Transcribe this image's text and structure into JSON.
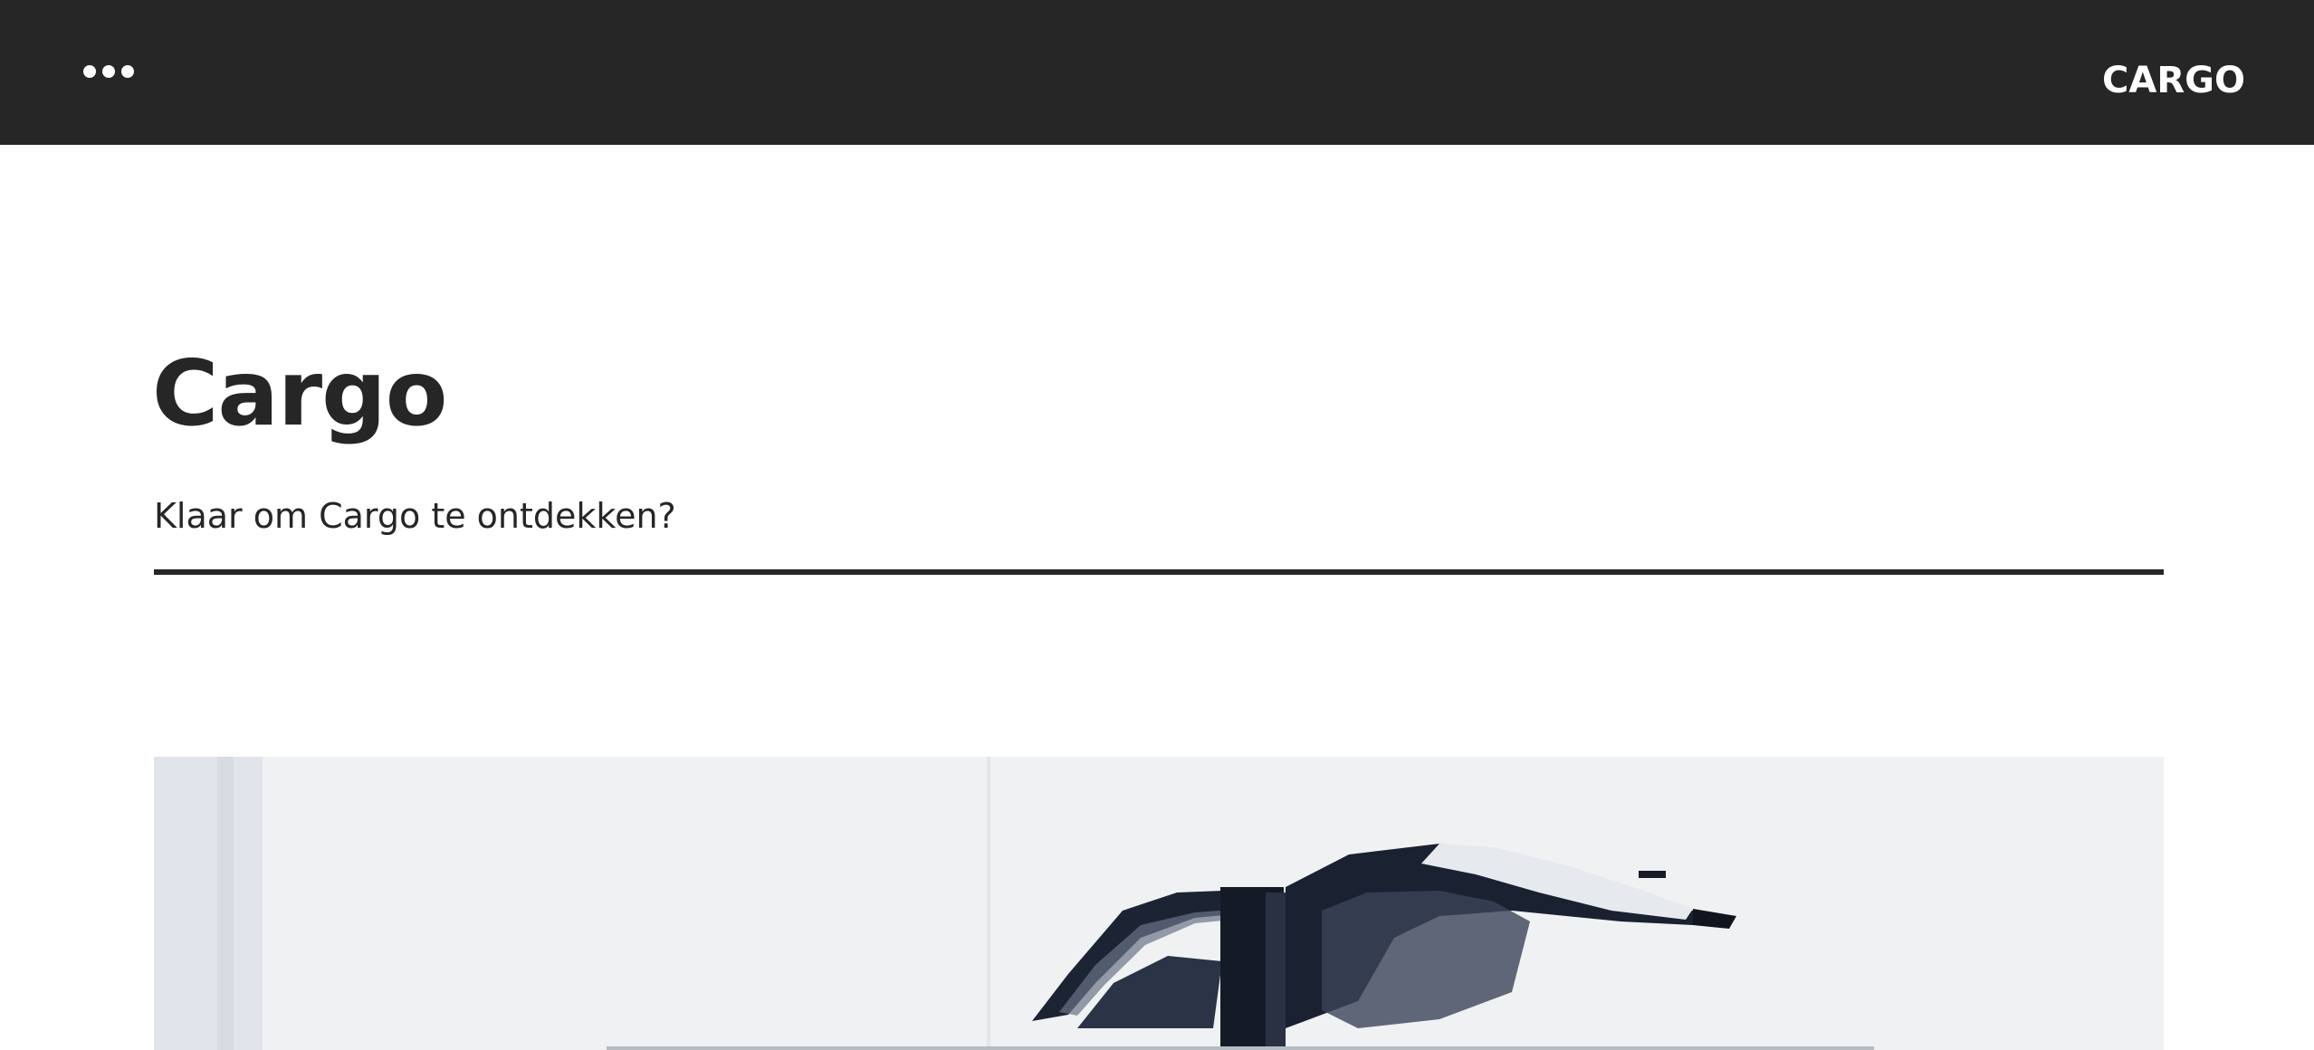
{
  "header": {
    "menu_icon": "more-dots-icon",
    "brand": "CARGO"
  },
  "main": {
    "title": "Cargo",
    "subtitle": "Klaar om Cargo te ontdekken?"
  },
  "hero": {
    "subject": "car-with-falcon-wing-doors-image"
  },
  "colors": {
    "header_bg": "#262626",
    "text": "#262626",
    "background": "#ffffff"
  }
}
